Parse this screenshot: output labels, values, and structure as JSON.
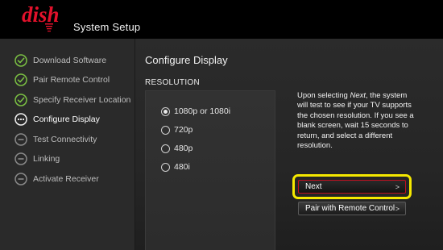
{
  "header": {
    "logo_text": "dish",
    "title": "System Setup"
  },
  "sidebar": {
    "steps": [
      {
        "label": "Download Software",
        "status": "complete",
        "icon": "check-circle-icon"
      },
      {
        "label": "Pair Remote Control",
        "status": "complete",
        "icon": "check-circle-icon"
      },
      {
        "label": "Specify Receiver Location",
        "status": "complete",
        "icon": "check-circle-icon"
      },
      {
        "label": "Configure Display",
        "status": "current",
        "icon": "ellipsis-circle-icon"
      },
      {
        "label": "Test Connectivity",
        "status": "pending",
        "icon": "minus-circle-icon"
      },
      {
        "label": "Linking",
        "status": "pending",
        "icon": "minus-circle-icon"
      },
      {
        "label": "Activate Receiver",
        "status": "pending",
        "icon": "minus-circle-icon"
      }
    ]
  },
  "main": {
    "title": "Configure Display",
    "section_label": "RESOLUTION",
    "options": [
      {
        "label": "1080p or 1080i",
        "selected": true
      },
      {
        "label": "720p",
        "selected": false
      },
      {
        "label": "480p",
        "selected": false
      },
      {
        "label": "480i",
        "selected": false
      }
    ],
    "info": {
      "before": "Upon selecting ",
      "emphasis": "Next",
      "after": ", the system will test to see if your TV supports the chosen resolution. If you see a blank screen, wait 15 seconds to return, and select a different resolution."
    },
    "buttons": {
      "next_label": "Next",
      "pair_label": "Pair with Remote Control",
      "chevron": ">"
    }
  },
  "colors": {
    "check_green": "#7bc043",
    "brand_red": "#e2112b",
    "highlight_yellow": "#f5e800"
  }
}
